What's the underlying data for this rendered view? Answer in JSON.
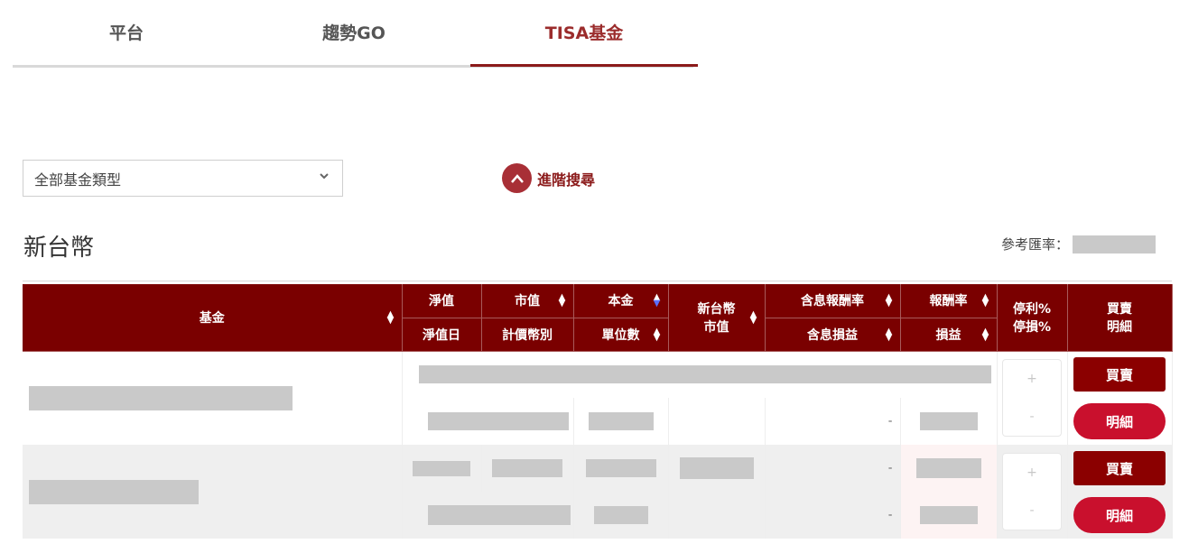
{
  "tabs": [
    {
      "label": "平台",
      "active": false
    },
    {
      "label": "趨勢GO",
      "active": false
    },
    {
      "label": "TISA基金",
      "active": true
    }
  ],
  "filter": {
    "fund_type_selected": "全部基金類型",
    "advanced_search_label": "進階搜尋"
  },
  "section": {
    "title": "新台幣",
    "exchange_rate_label": "參考匯率："
  },
  "table": {
    "headers": {
      "fund": "基金",
      "nav": "淨值",
      "nav_date": "淨值日",
      "market_value": "市值",
      "currency": "計價幣別",
      "principal": "本金",
      "units": "單位數",
      "twd_value_line1": "新台幣",
      "twd_value_line2": "市值",
      "return_with_div": "含息報酬率",
      "pl_with_div": "含息損益",
      "return_rate": "報酬率",
      "pl": "損益",
      "tp_sl_line1": "停利%",
      "tp_sl_line2": "停損%",
      "trade_line1": "買賣",
      "trade_line2": "明細"
    },
    "rows": [
      {
        "pl_with_div": "-",
        "tp_plus": "+",
        "tp_minus": "-",
        "buy_label": "買賣",
        "detail_label": "明細"
      },
      {
        "return_with_div": "-",
        "pl_with_div": "-",
        "tp_plus": "+",
        "tp_minus": "-",
        "buy_label": "買賣",
        "detail_label": "明細"
      }
    ]
  },
  "colors": {
    "header_bg": "#7a0000",
    "accent": "#8b1a1a",
    "detail_button": "#c9102d"
  }
}
